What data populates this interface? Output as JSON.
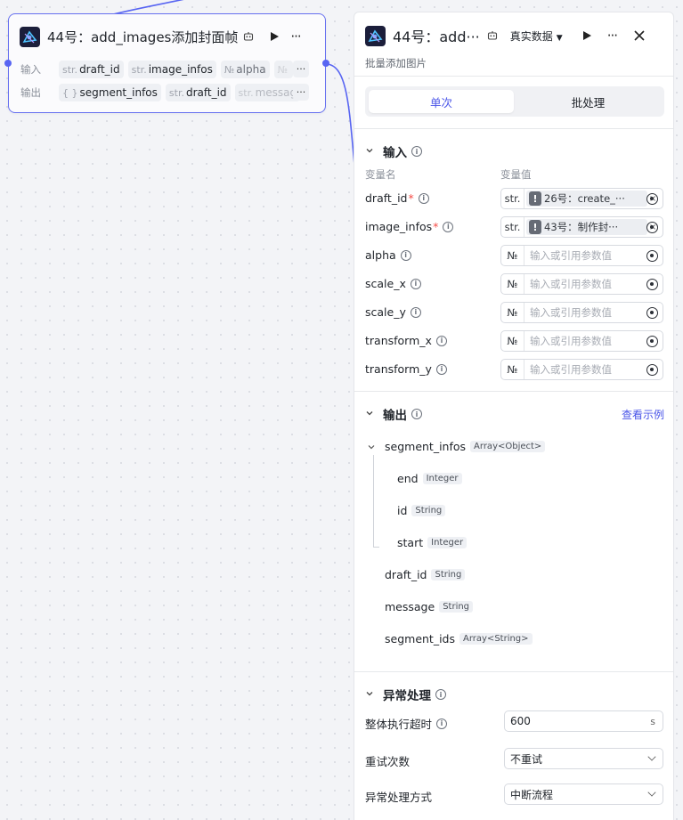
{
  "node": {
    "title": "44号：add_images添加封面帧",
    "input_label": "输入",
    "output_label": "输出",
    "inputs": [
      {
        "type": "str.",
        "name": "draft_id"
      },
      {
        "type": "str.",
        "name": "image_infos"
      },
      {
        "type": "№",
        "name": "alpha"
      },
      {
        "type": "№",
        "name": ""
      }
    ],
    "outputs": [
      {
        "type": "{ }",
        "name": "segment_infos"
      },
      {
        "type": "str.",
        "name": "draft_id"
      },
      {
        "type": "str.",
        "name": "messag"
      }
    ],
    "more": "···"
  },
  "panel": {
    "title": "44号：add···",
    "data_source": "真实数据",
    "subtitle": "批量添加图片",
    "tabs": [
      "单次",
      "批处理"
    ],
    "input_section": "输入",
    "col_name": "变量名",
    "col_value": "变量值",
    "params": [
      {
        "name": "draft_id",
        "required": true,
        "type": "str.",
        "ref": "26号：create_···",
        "placeholder": ""
      },
      {
        "name": "image_infos",
        "required": true,
        "type": "str.",
        "ref": "43号：制作封···",
        "placeholder": ""
      },
      {
        "name": "alpha",
        "required": false,
        "type": "№",
        "ref": "",
        "placeholder": "输入或引用参数值"
      },
      {
        "name": "scale_x",
        "required": false,
        "type": "№",
        "ref": "",
        "placeholder": "输入或引用参数值"
      },
      {
        "name": "scale_y",
        "required": false,
        "type": "№",
        "ref": "",
        "placeholder": "输入或引用参数值"
      },
      {
        "name": "transform_x",
        "required": false,
        "type": "№",
        "ref": "",
        "placeholder": "输入或引用参数值"
      },
      {
        "name": "transform_y",
        "required": false,
        "type": "№",
        "ref": "",
        "placeholder": "输入或引用参数值"
      }
    ],
    "output_section": "输出",
    "view_example": "查看示例",
    "outputs": [
      {
        "name": "segment_infos",
        "type": "Array<Object>",
        "children": [
          {
            "name": "end",
            "type": "Integer"
          },
          {
            "name": "id",
            "type": "String"
          },
          {
            "name": "start",
            "type": "Integer"
          }
        ]
      },
      {
        "name": "draft_id",
        "type": "String"
      },
      {
        "name": "message",
        "type": "String"
      },
      {
        "name": "segment_ids",
        "type": "Array<String>"
      }
    ],
    "error_section": "异常处理",
    "timeout_label": "整体执行超时",
    "timeout_value": "600",
    "timeout_unit": "s",
    "retry_label": "重试次数",
    "retry_value": "不重试",
    "handling_label": "异常处理方式",
    "handling_value": "中断流程"
  },
  "colors": {
    "accent": "#4a55e8",
    "node_border": "#6670f0",
    "required": "#f54a45"
  }
}
